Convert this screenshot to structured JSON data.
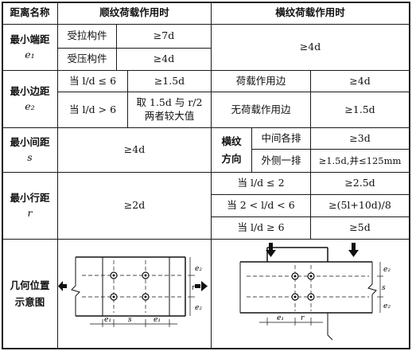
{
  "header": {
    "col1": "距离名称",
    "col2": "顺纹荷载作用时",
    "col3": "横纹荷载作用时"
  },
  "end_distance": {
    "name": "最小端距",
    "symbol": "e₁",
    "tension_label": "受拉构件",
    "tension_value": "≥7d",
    "compression_label": "受压构件",
    "compression_value": "≥4d",
    "cross_value": "≥4d"
  },
  "edge_distance": {
    "name": "最小边距",
    "symbol": "e₂",
    "cond1": "当 l/d ≤ 6",
    "cond1_value": "≥1.5d",
    "cond2": "当 l/d > 6",
    "cond2_value_line1": "取 1.5d 与 r/2",
    "cond2_value_line2": "两者较大值",
    "loaded_edge": "荷载作用边",
    "loaded_edge_value": "≥4d",
    "unloaded_edge": "无荷载作用边",
    "unloaded_edge_value": "≥1.5d"
  },
  "spacing": {
    "name": "最小间距",
    "symbol": "s",
    "parallel_value": "≥4d",
    "cross_dir_line1": "横纹",
    "cross_dir_line2": "方向",
    "middle_rows": "中间各排",
    "middle_rows_value": "≥3d",
    "outer_row": "外侧一排",
    "outer_row_value": "≥1.5d,并≤125mm"
  },
  "row_distance": {
    "name": "最小行距",
    "symbol": "r",
    "parallel_value": "≥2d",
    "cond1": "当 l/d ≤ 2",
    "cond1_value": "≥2.5d",
    "cond2": "当 2 < l/d < 6",
    "cond2_value": "≥(5l+10d)/8",
    "cond3": "当 l/d ≥ 6",
    "cond3_value": "≥5d"
  },
  "diagram_row": {
    "name_line1": "几何位置",
    "name_line2": "示意图",
    "left_labels": {
      "e1": "e₁",
      "s": "s",
      "e2": "e₂",
      "r": "r"
    },
    "right_labels": {
      "e1": "e₁",
      "r": "r",
      "e2": "e₂",
      "s": "s"
    }
  }
}
